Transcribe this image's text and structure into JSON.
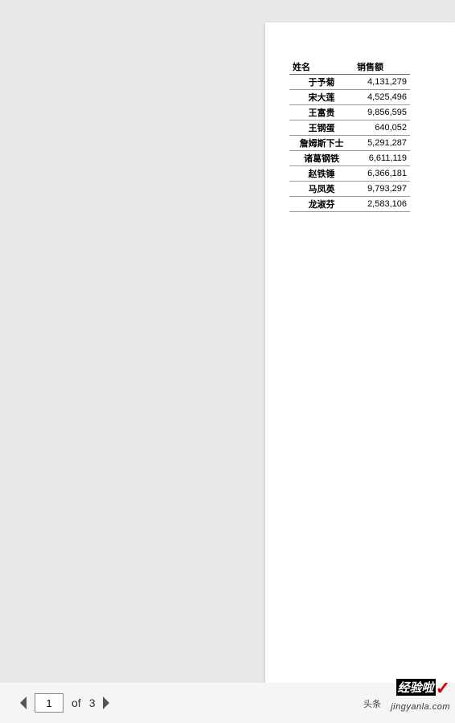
{
  "table": {
    "headers": {
      "name": "姓名",
      "sales": "销售额"
    },
    "rows": [
      {
        "name": "于予菊",
        "sales": "4,131,279"
      },
      {
        "name": "宋大莲",
        "sales": "4,525,496"
      },
      {
        "name": "王富贵",
        "sales": "9,856,595"
      },
      {
        "name": "王钢蛋",
        "sales": "640,052"
      },
      {
        "name": "詹姆斯下士",
        "sales": "5,291,287"
      },
      {
        "name": "诸葛钢铁",
        "sales": "6,611,119"
      },
      {
        "name": "赵铁锤",
        "sales": "6,366,181"
      },
      {
        "name": "马凤英",
        "sales": "9,793,297"
      },
      {
        "name": "龙淑芬",
        "sales": "2,583,106"
      }
    ]
  },
  "pager": {
    "current": "1",
    "of_label": "of",
    "total": "3"
  },
  "watermark": {
    "brand": "经验啦",
    "prefix": "头条",
    "url": "jingyanla.com"
  }
}
